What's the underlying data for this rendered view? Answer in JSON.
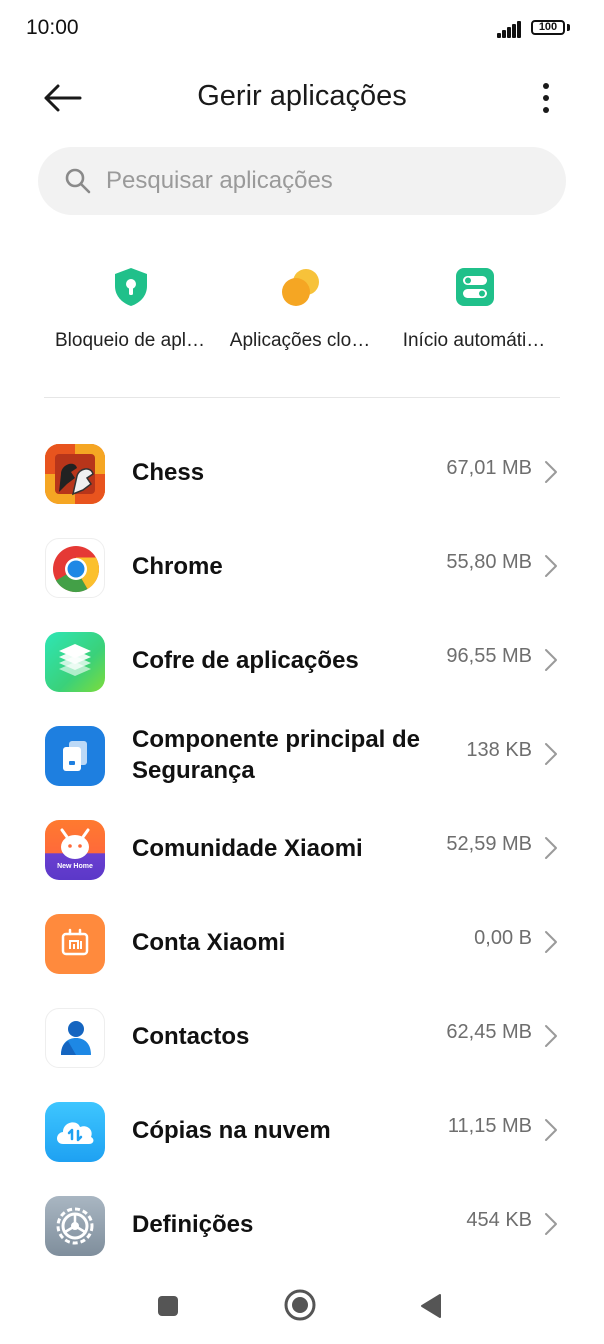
{
  "status": {
    "time": "10:00",
    "battery": "100"
  },
  "header": {
    "title": "Gerir aplicações"
  },
  "search": {
    "placeholder": "Pesquisar aplicações"
  },
  "shortcuts": [
    {
      "label": "Bloqueio de apl…",
      "icon": "shield-lock-icon",
      "color": "#20c08a"
    },
    {
      "label": "Aplicações clo…",
      "icon": "dual-apps-icon",
      "color": "#f5a623"
    },
    {
      "label": "Início automáti…",
      "icon": "autostart-toggle-icon",
      "color": "#20c08a"
    }
  ],
  "apps": [
    {
      "name": "Chess",
      "size": "67,01 MB",
      "icon": "chess-icon"
    },
    {
      "name": "Chrome",
      "size": "55,80 MB",
      "icon": "chrome-icon"
    },
    {
      "name": "Cofre de aplicações",
      "size": "96,55 MB",
      "icon": "app-vault-icon"
    },
    {
      "name": "Componente principal de Segurança",
      "size": "138 KB",
      "icon": "security-component-icon"
    },
    {
      "name": "Comunidade Xiaomi",
      "size": "52,59 MB",
      "icon": "xiaomi-community-icon",
      "badge": "New Home"
    },
    {
      "name": "Conta Xiaomi",
      "size": "0,00 B",
      "icon": "xiaomi-account-icon"
    },
    {
      "name": "Contactos",
      "size": "62,45 MB",
      "icon": "contacts-icon"
    },
    {
      "name": "Cópias na nuvem",
      "size": "11,15 MB",
      "icon": "cloud-backup-icon"
    },
    {
      "name": "Definições",
      "size": "454 KB",
      "icon": "settings-icon"
    }
  ]
}
